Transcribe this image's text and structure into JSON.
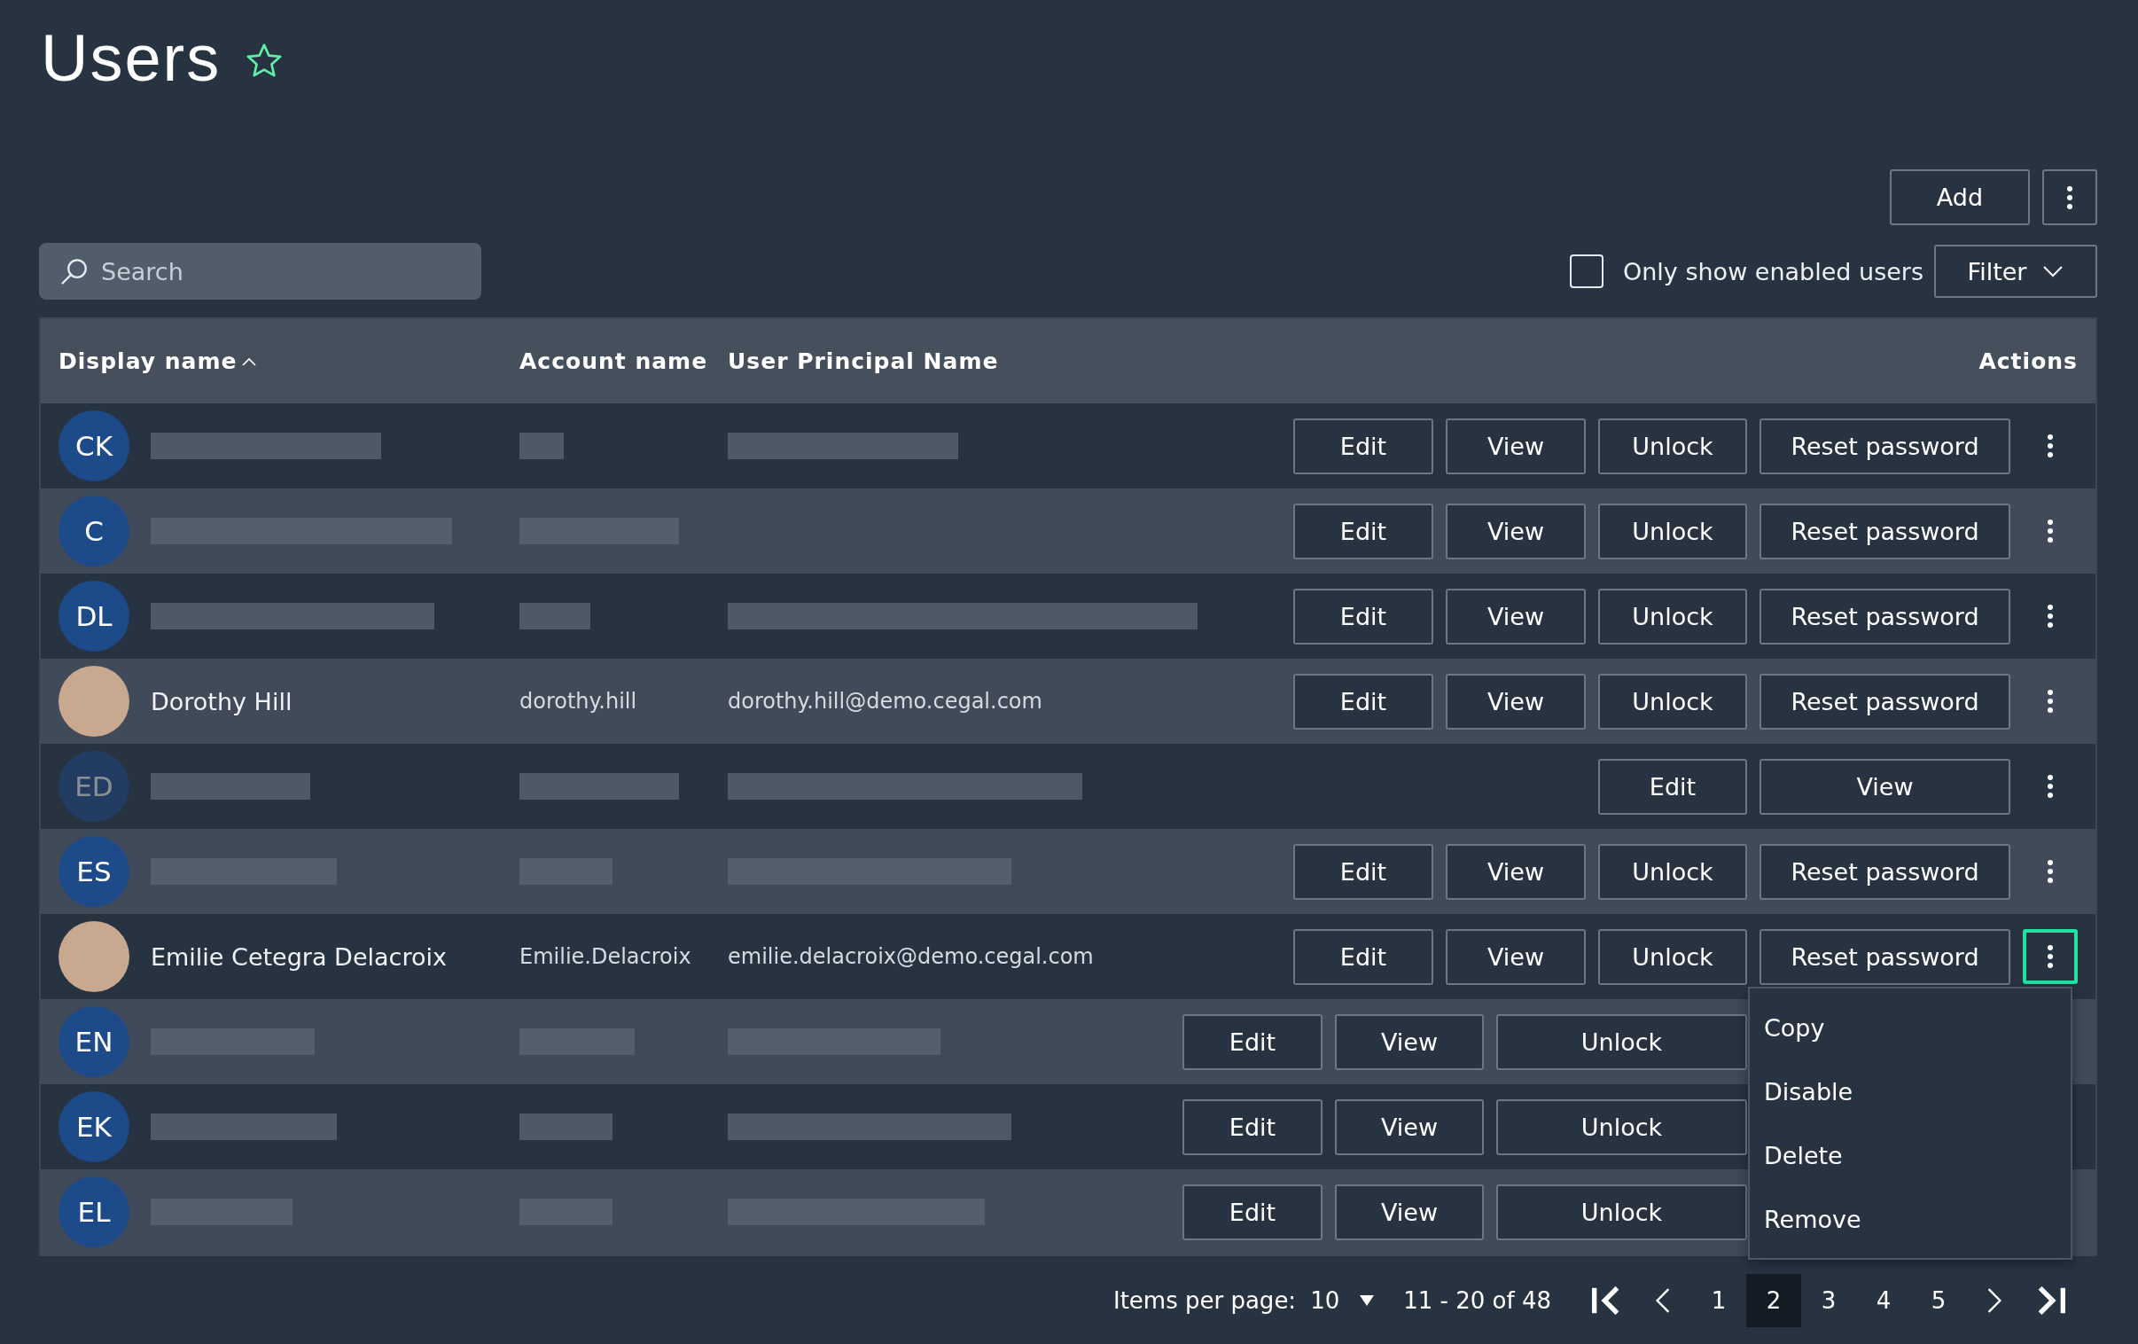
{
  "page": {
    "title": "Users",
    "favorite": false
  },
  "toolbar": {
    "add_label": "Add",
    "checkbox": {
      "label": "Only show enabled users",
      "checked": false
    },
    "filter_label": "Filter"
  },
  "search": {
    "placeholder": "Search"
  },
  "table": {
    "columns": [
      {
        "label": "Display name",
        "sorted": true
      },
      {
        "label": "Account name",
        "sorted": false
      },
      {
        "label": "User Principal Name",
        "sorted": false
      },
      {
        "label": "Actions",
        "sorted": false
      }
    ],
    "rows": [
      {
        "kind": "initials",
        "initials": "CK",
        "redacted": true,
        "disabled": false,
        "menu_open": false,
        "covered": false,
        "actions": [
          "Edit",
          "View",
          "Unlock",
          "Reset password"
        ]
      },
      {
        "kind": "initials",
        "initials": "C",
        "redacted": true,
        "disabled": false,
        "menu_open": false,
        "covered": false,
        "actions": [
          "Edit",
          "View",
          "Unlock",
          "Reset password"
        ]
      },
      {
        "kind": "initials",
        "initials": "DL",
        "redacted": true,
        "disabled": false,
        "menu_open": false,
        "covered": false,
        "actions": [
          "Edit",
          "View",
          "Unlock",
          "Reset password"
        ]
      },
      {
        "kind": "photo",
        "name": "Dorothy Hill",
        "account": "dorothy.hill",
        "upn": "dorothy.hill@demo.cegal.com",
        "redacted": false,
        "disabled": false,
        "menu_open": false,
        "covered": false,
        "actions": [
          "Edit",
          "View",
          "Unlock",
          "Reset password"
        ]
      },
      {
        "kind": "initials",
        "initials": "ED",
        "redacted": true,
        "disabled": true,
        "menu_open": false,
        "covered": false,
        "actions": [
          "Edit",
          "View"
        ]
      },
      {
        "kind": "initials",
        "initials": "ES",
        "redacted": true,
        "disabled": false,
        "menu_open": false,
        "covered": false,
        "actions": [
          "Edit",
          "View",
          "Unlock",
          "Reset password"
        ]
      },
      {
        "kind": "photo",
        "name": "Emilie Cetegra Delacroix",
        "account": "Emilie.Delacroix",
        "upn": "emilie.delacroix@demo.cegal.com",
        "redacted": false,
        "disabled": false,
        "menu_open": true,
        "covered": false,
        "actions": [
          "Edit",
          "View",
          "Unlock",
          "Reset password"
        ]
      },
      {
        "kind": "initials",
        "initials": "EN",
        "redacted": true,
        "disabled": false,
        "menu_open": false,
        "covered": true,
        "actions": [
          "Edit",
          "View",
          "Unlock"
        ]
      },
      {
        "kind": "initials",
        "initials": "EK",
        "redacted": true,
        "disabled": false,
        "menu_open": false,
        "covered": true,
        "actions": [
          "Edit",
          "View",
          "Unlock"
        ]
      },
      {
        "kind": "initials",
        "initials": "EL",
        "redacted": true,
        "disabled": false,
        "menu_open": false,
        "covered": true,
        "actions": [
          "Edit",
          "View",
          "Unlock"
        ]
      }
    ]
  },
  "row_menu": {
    "items": [
      "Copy",
      "Disable",
      "Delete",
      "Remove"
    ]
  },
  "pagination": {
    "items_per_page_label": "Items per page:",
    "items_per_page": "10",
    "range": "11 - 20 of 48",
    "pages": [
      {
        "label": "1",
        "selected": false
      },
      {
        "label": "2",
        "selected": true
      },
      {
        "label": "3",
        "selected": false
      },
      {
        "label": "4",
        "selected": false
      },
      {
        "label": "5",
        "selected": false
      }
    ]
  }
}
